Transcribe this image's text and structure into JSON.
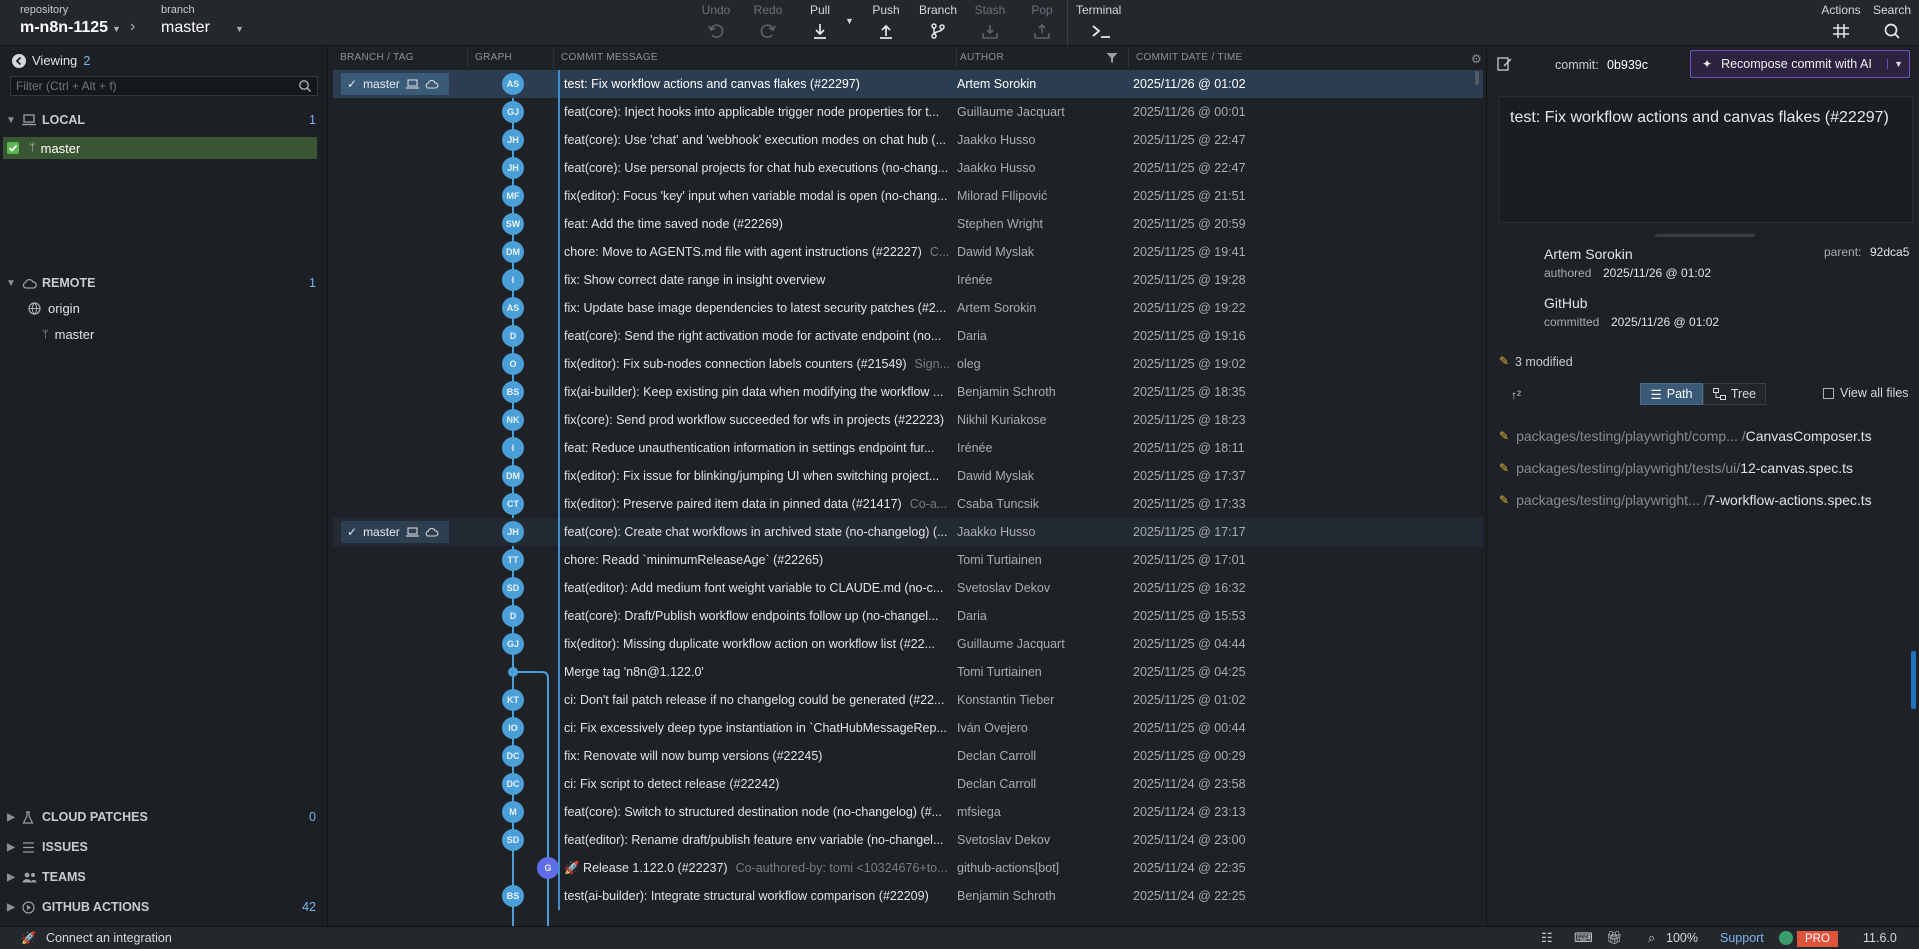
{
  "topbar": {
    "repo_label": "repository",
    "repo_name": "m-n8n-1125",
    "branch_label": "branch",
    "branch_name": "master",
    "undo": "Undo",
    "redo": "Redo",
    "pull": "Pull",
    "push": "Push",
    "branch": "Branch",
    "stash": "Stash",
    "pop": "Pop",
    "terminal": "Terminal",
    "actions": "Actions",
    "search": "Search"
  },
  "sidebar": {
    "viewing_label": "Viewing",
    "viewing_count": "2",
    "filter_placeholder": "Filter (Ctrl + Alt + f)",
    "local": {
      "title": "LOCAL",
      "count": "1",
      "branch": "master"
    },
    "remote": {
      "title": "REMOTE",
      "count": "1",
      "origin": "origin",
      "branch": "master"
    },
    "cloud_patches": {
      "title": "CLOUD PATCHES",
      "count": "0"
    },
    "issues": {
      "title": "ISSUES"
    },
    "teams": {
      "title": "TEAMS"
    },
    "github_actions": {
      "title": "GITHUB ACTIONS",
      "count": "42"
    }
  },
  "graph": {
    "headers": {
      "branch_tag": "BRANCH / TAG",
      "graph": "GRAPH",
      "message": "COMMIT MESSAGE",
      "author": "AUTHOR",
      "date": "COMMIT DATE / TIME"
    },
    "branch_pill_label": "master",
    "commits": [
      {
        "initials": "AS",
        "message": "test: Fix workflow actions and canvas flakes (#22297)",
        "coauth": "",
        "author": "Artem Sorokin",
        "date": "2025/11/26 @ 01:02"
      },
      {
        "initials": "GJ",
        "message": "feat(core): Inject hooks into applicable trigger node properties for t...",
        "coauth": "",
        "author": "Guillaume Jacquart",
        "date": "2025/11/26 @ 00:01"
      },
      {
        "initials": "JH",
        "message": "feat(core): Use 'chat' and 'webhook' execution modes on chat hub (...",
        "coauth": "",
        "author": "Jaakko Husso",
        "date": "2025/11/25 @ 22:47"
      },
      {
        "initials": "JH",
        "message": "feat(core): Use personal projects for chat hub executions (no-chang...",
        "coauth": "",
        "author": "Jaakko Husso",
        "date": "2025/11/25 @ 22:47"
      },
      {
        "initials": "MF",
        "message": "fix(editor): Focus 'key' input when variable modal is open (no-chang...",
        "coauth": "",
        "author": "Milorad FIlipović",
        "date": "2025/11/25 @ 21:51"
      },
      {
        "initials": "SW",
        "message": "feat: Add the time saved node (#22269)",
        "coauth": "",
        "author": "Stephen Wright",
        "date": "2025/11/25 @ 20:59"
      },
      {
        "initials": "DM",
        "message": "chore: Move to AGENTS.md file with agent instructions (#22227)",
        "coauth": "C...",
        "author": "Dawid Myslak",
        "date": "2025/11/25 @ 19:41"
      },
      {
        "initials": "I",
        "message": "fix: Show correct date range in insight overview",
        "coauth": "",
        "author": "Irénée",
        "date": "2025/11/25 @ 19:28"
      },
      {
        "initials": "AS",
        "message": "fix: Update base image dependencies to latest security patches (#2...",
        "coauth": "",
        "author": "Artem Sorokin",
        "date": "2025/11/25 @ 19:22"
      },
      {
        "initials": "D",
        "message": "feat(core): Send the right activation mode for activate endpoint (no...",
        "coauth": "",
        "author": "Daria",
        "date": "2025/11/25 @ 19:16"
      },
      {
        "initials": "O",
        "message": "fix(editor): Fix sub-nodes connection labels counters (#21549)",
        "coauth": "Sign...",
        "author": "oleg",
        "date": "2025/11/25 @ 19:02"
      },
      {
        "initials": "BS",
        "message": "fix(ai-builder): Keep existing pin data when modifying the workflow ...",
        "coauth": "",
        "author": "Benjamin Schroth",
        "date": "2025/11/25 @ 18:35"
      },
      {
        "initials": "NK",
        "message": "fix(core): Send prod workflow succeeded for wfs in projects (#22223)",
        "coauth": "",
        "author": "Nikhil Kuriakose",
        "date": "2025/11/25 @ 18:23"
      },
      {
        "initials": "I",
        "message": "feat: Reduce unauthentication information in settings endpoint fur...",
        "coauth": "",
        "author": "Irénée",
        "date": "2025/11/25 @ 18:11"
      },
      {
        "initials": "DM",
        "message": "fix(editor): Fix issue for blinking/jumping UI when switching project...",
        "coauth": "",
        "author": "Dawid Myslak",
        "date": "2025/11/25 @ 17:37"
      },
      {
        "initials": "CT",
        "message": "fix(editor): Preserve paired item data in pinned data (#21417)",
        "coauth": "Co-a...",
        "author": "Csaba Tuncsik",
        "date": "2025/11/25 @ 17:33"
      },
      {
        "initials": "JH",
        "message": "feat(core): Create chat workflows in archived state (no-changelog) (...",
        "coauth": "",
        "author": "Jaakko Husso",
        "date": "2025/11/25 @ 17:17"
      },
      {
        "initials": "TT",
        "message": "chore: Readd `minimumReleaseAge` (#22265)",
        "coauth": "",
        "author": "Tomi Turtiainen",
        "date": "2025/11/25 @ 17:01"
      },
      {
        "initials": "SD",
        "message": "feat(editor): Add medium font weight variable to CLAUDE.md (no-c...",
        "coauth": "",
        "author": "Svetoslav Dekov",
        "date": "2025/11/25 @ 16:32"
      },
      {
        "initials": "D",
        "message": "feat(core): Draft/Publish workflow endpoints follow up (no-changel...",
        "coauth": "",
        "author": "Daria",
        "date": "2025/11/25 @ 15:53"
      },
      {
        "initials": "GJ",
        "message": "fix(editor): Missing duplicate workflow action on workflow list (#22...",
        "coauth": "",
        "author": "Guillaume Jacquart",
        "date": "2025/11/25 @ 04:44"
      },
      {
        "initials": "",
        "message": "Merge tag 'n8n@1.122.0'",
        "coauth": "",
        "author": "Tomi Turtiainen",
        "date": "2025/11/25 @ 04:25"
      },
      {
        "initials": "KT",
        "message": "ci: Don't fail patch release if no changelog could be generated (#22...",
        "coauth": "",
        "author": "Konstantin Tieber",
        "date": "2025/11/25 @ 01:02"
      },
      {
        "initials": "IO",
        "message": "ci: Fix excessively deep type instantiation in `ChatHubMessageRep...",
        "coauth": "",
        "author": "Iván Ovejero",
        "date": "2025/11/25 @ 00:44"
      },
      {
        "initials": "DC",
        "message": "fix: Renovate will now bump versions (#22245)",
        "coauth": "",
        "author": "Declan Carroll",
        "date": "2025/11/25 @ 00:29"
      },
      {
        "initials": "DC",
        "message": "ci: Fix script to detect release (#22242)",
        "coauth": "",
        "author": "Declan Carroll",
        "date": "2025/11/24 @ 23:58"
      },
      {
        "initials": "M",
        "message": "feat(core): Switch to structured destination node (no-changelog) (#...",
        "coauth": "",
        "author": "mfsiega",
        "date": "2025/11/24 @ 23:13"
      },
      {
        "initials": "SD",
        "message": "feat(editor): Rename draft/publish feature env variable (no-changel...",
        "coauth": "",
        "author": "Svetoslav Dekov",
        "date": "2025/11/24 @ 23:00"
      },
      {
        "initials": "G",
        "message": "🚀 Release 1.122.0 (#22237)",
        "coauth": "Co-authored-by: tomi <10324676+to...",
        "author": "github-actions[bot]",
        "date": "2025/11/24 @ 22:35"
      },
      {
        "initials": "BS",
        "message": "test(ai-builder): Integrate structural workflow comparison (#22209)",
        "coauth": "",
        "author": "Benjamin Schroth",
        "date": "2025/11/24 @ 22:25"
      }
    ]
  },
  "detail": {
    "commit_label": "commit:",
    "commit_sha": "0b939c",
    "recompose_label": "Recompose commit with AI",
    "message": "test: Fix workflow actions and canvas flakes (#22297)",
    "author_name": "Artem Sorokin",
    "authored_label": "authored",
    "authored_date": "2025/11/26 @ 01:02",
    "parent_label": "parent:",
    "parent_sha": "92dca5",
    "committer_name": "GitHub",
    "committed_label": "committed",
    "committed_date": "2025/11/26 @ 01:02",
    "modified_label": "3 modified",
    "path_label": "Path",
    "tree_label": "Tree",
    "view_all_label": "View all files",
    "files": [
      {
        "dir": "packages/testing/playwright/comp... /",
        "name": "CanvasComposer.ts"
      },
      {
        "dir": "packages/testing/playwright/tests/ui/",
        "name": "12-canvas.spec.ts"
      },
      {
        "dir": "packages/testing/playwright... /",
        "name": "7-workflow-actions.spec.ts"
      }
    ]
  },
  "statusbar": {
    "integration": "Connect an integration",
    "zoom": "100%",
    "support": "Support",
    "pro": "PRO",
    "version": "11.6.0"
  },
  "colors": {
    "accent": "#4b9fd8",
    "selected_row": "#2c3d52",
    "pro": "#e0533d",
    "link": "#7ab4ef",
    "local_branch_bg": "#3a5532"
  }
}
